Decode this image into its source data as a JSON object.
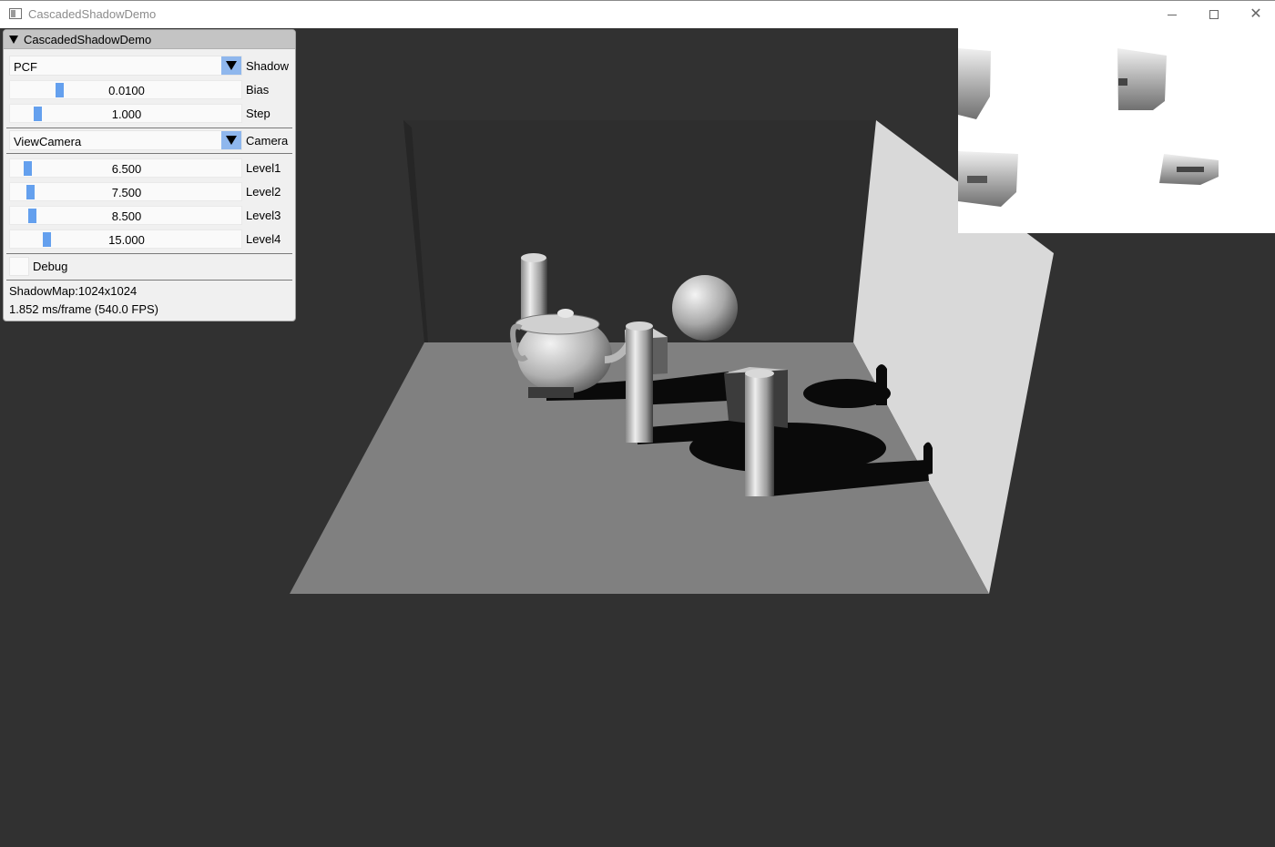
{
  "window": {
    "title": "CascadedShadowDemo"
  },
  "panel": {
    "title": "CascadedShadowDemo",
    "shadow_combo": {
      "value": "PCF",
      "label": "Shadow"
    },
    "bias": {
      "value": "0.0100",
      "label": "Bias",
      "level": 0.2
    },
    "step": {
      "value": "1.000",
      "label": "Step",
      "level": 0.1
    },
    "camera_combo": {
      "value": "ViewCamera",
      "label": "Camera"
    },
    "levels": [
      {
        "value": "6.500",
        "label": "Level1",
        "level": 0.065
      },
      {
        "value": "7.500",
        "label": "Level2",
        "level": 0.075
      },
      {
        "value": "8.500",
        "label": "Level3",
        "level": 0.085
      },
      {
        "value": "15.000",
        "label": "Level4",
        "level": 0.15
      }
    ],
    "debug": {
      "label": "Debug",
      "checked": false
    },
    "shadowmap_info": "ShadowMap:1024x1024",
    "frame_info": "1.852 ms/frame (540.0 FPS)"
  },
  "colors": {
    "background": "#313131",
    "slider_grab": "#64a0ee",
    "combo_button": "#8fb7ed"
  }
}
